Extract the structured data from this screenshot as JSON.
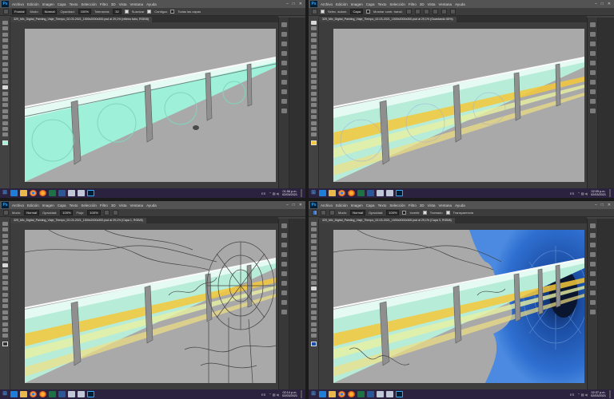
{
  "menu": [
    "Archivo",
    "Edición",
    "Imagen",
    "Capa",
    "Texto",
    "Selección",
    "Filtro",
    "3D",
    "Vista",
    "Ventana",
    "Ayuda"
  ],
  "window_controls": [
    "–",
    "□",
    "✕"
  ],
  "app_logo": "Ps",
  "panels": [
    {
      "tool_options": {
        "mode_label": "Modo:",
        "mode": "Normal",
        "opacity_label": "Opacidad:",
        "opacity": "100%",
        "tolerance_label": "Tolerancia:",
        "tolerance": "32",
        "smooth": "Suavizar",
        "contiguous": "Contiguo",
        "all_layers": "Todas las capas",
        "preset": "Frontal"
      },
      "doc_tab": "329_Mix_Digital_Painting_Viaje_Tiempo_02-03-2021_1500x2000x300.psd al 29,1% (relleno tubo, RGB/8)",
      "zoom": "29,48%",
      "doc_size": "Doc: 26,8 MB/130,4 MB",
      "clock_time": "01:56 p.m.",
      "clock_date": "02/03/2021"
    },
    {
      "tool_options": {
        "preset": "Selec. autom.",
        "target": "Capa",
        "transform": "Mostrar contr. transf."
      },
      "doc_tab": "329_Mix_Digital_Painting_Viaje_Tiempo_02-03-2021_1500x2000x300.psd al 29,1% (Guardando 65%)",
      "zoom": "29,48%",
      "progress_label": "Guardando 65%",
      "progress": 0.65,
      "clock_time": "02:05 p.m.",
      "clock_date": "02/03/2021"
    },
    {
      "tool_options": {
        "mode_label": "Modo:",
        "mode": "Normal",
        "opacity_label": "Opacidad:",
        "opacity": "100%",
        "flow_label": "Flujo:",
        "flow": "100%"
      },
      "doc_tab": "329_Mix_Digital_Painting_Viaje_Tiempo_02-03-2021_1500x2000x300.psd al 29,1% (Capa 1, RGB/8)",
      "zoom": "29,48%",
      "doc_size": "Doc: 26,8 MB/198,9 MB",
      "clock_time": "02:14 p.m.",
      "clock_date": "02/03/2021"
    },
    {
      "tool_options": {
        "mode_label": "Modo:",
        "mode": "Normal",
        "opacity_label": "Opacidad:",
        "opacity": "100%",
        "invert": "Invertir",
        "dither": "Tramado",
        "transparency": "Transparencia"
      },
      "doc_tab": "329_Mix_Digital_Painting_Viaje_Tiempo_02-03-2021_1500x2000x300.psd al 29,1% (Capa 3, RGB/8)",
      "zoom": "29,48%",
      "doc_size": "Doc: 26,8 MB/218,9 MB",
      "clock_time": "02:37 p.m.",
      "clock_date": "02/03/2021"
    }
  ],
  "taskbar": {
    "start_icon": "windows-logo",
    "tray_lang": "ES",
    "tray_arrows": "⌃ ▤ ◂)"
  },
  "colors": {
    "tube_fill": "#9ff0d8",
    "tube_glass": "#d8f6ea",
    "energy_yellow": "#f4c83a",
    "vortex_blue": "#1b4fa8",
    "canvas_gray": "#a9a9a9",
    "accent_blue": "#2f6fe0"
  }
}
